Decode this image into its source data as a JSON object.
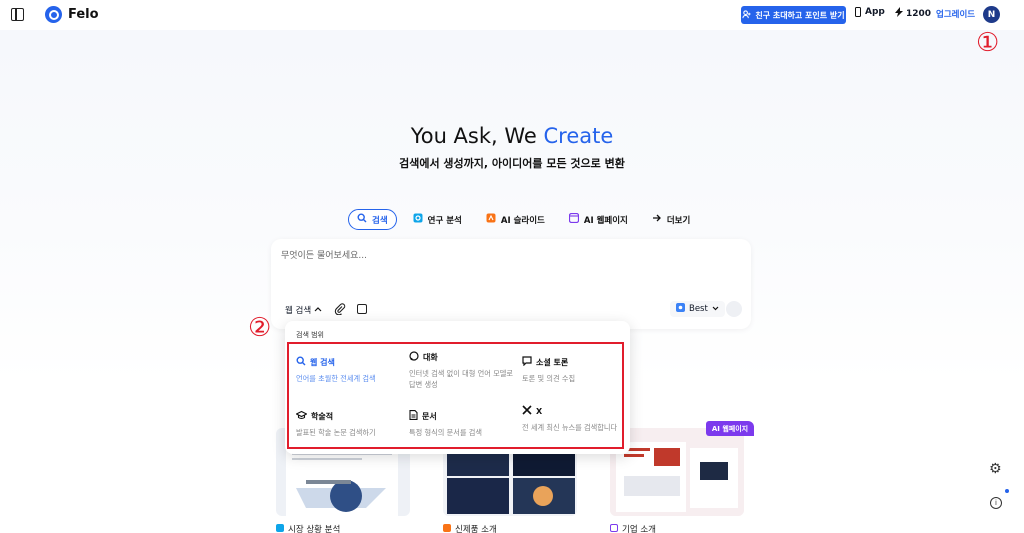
{
  "header": {
    "logo_text": "Felo",
    "invite_label": "친구 초대하고 포인트 받기",
    "app_label": "App",
    "points": "1200",
    "upgrade_label": "업그레이드",
    "avatar_initial": "N"
  },
  "annotations": {
    "one": "①",
    "two": "②"
  },
  "hero": {
    "title_plain": "You Ask, We ",
    "title_accent": "Create",
    "subtitle": "검색에서 생성까지, 아이디어를 모든 것으로 변환"
  },
  "tabs": [
    {
      "label": "검색",
      "icon": "search-icon",
      "active": true
    },
    {
      "label": "연구 분석",
      "icon": "research-icon"
    },
    {
      "label": "AI 슬라이드",
      "icon": "slides-icon"
    },
    {
      "label": "AI 웹페이지",
      "icon": "webpage-icon"
    },
    {
      "label": "더보기",
      "icon": "arrow-right-icon"
    }
  ],
  "input": {
    "placeholder": "무엇이든 물어보세요...",
    "scope_label": "웹 검색",
    "model_label": "Best"
  },
  "dropdown": {
    "title": "검색 범위",
    "options": [
      {
        "name": "웹 검색",
        "desc": "언어를 초월한 전세계 검색",
        "icon": "search-icon",
        "selected": true
      },
      {
        "name": "대화",
        "desc": "인터넷 검색 없이 대형 언어 모델로 답변 생성",
        "icon": "chat-icon"
      },
      {
        "name": "소셜 토론",
        "desc": "토론 및 의견 수집",
        "icon": "comment-icon"
      },
      {
        "name": "학술적",
        "desc": "발표된 학술 논문 검색하기",
        "icon": "graduation-cap-icon"
      },
      {
        "name": "문서",
        "desc": "특정 형식의 문서를 검색",
        "icon": "document-icon"
      },
      {
        "name": "X",
        "desc": "전 세계 최신 뉴스를 검색합니다",
        "icon": "x-logo-icon"
      }
    ]
  },
  "cards": [
    {
      "label": "시장 상황 분석",
      "icon": "research-icon"
    },
    {
      "label": "신제품 소개",
      "icon": "slides-icon"
    },
    {
      "label": "기업 소개",
      "icon": "webpage-icon"
    }
  ],
  "badge": "AI 웹페이지",
  "colors": {
    "accent": "#2563eb",
    "annotation": "#e11d2c",
    "badge": "#7c3aed"
  }
}
